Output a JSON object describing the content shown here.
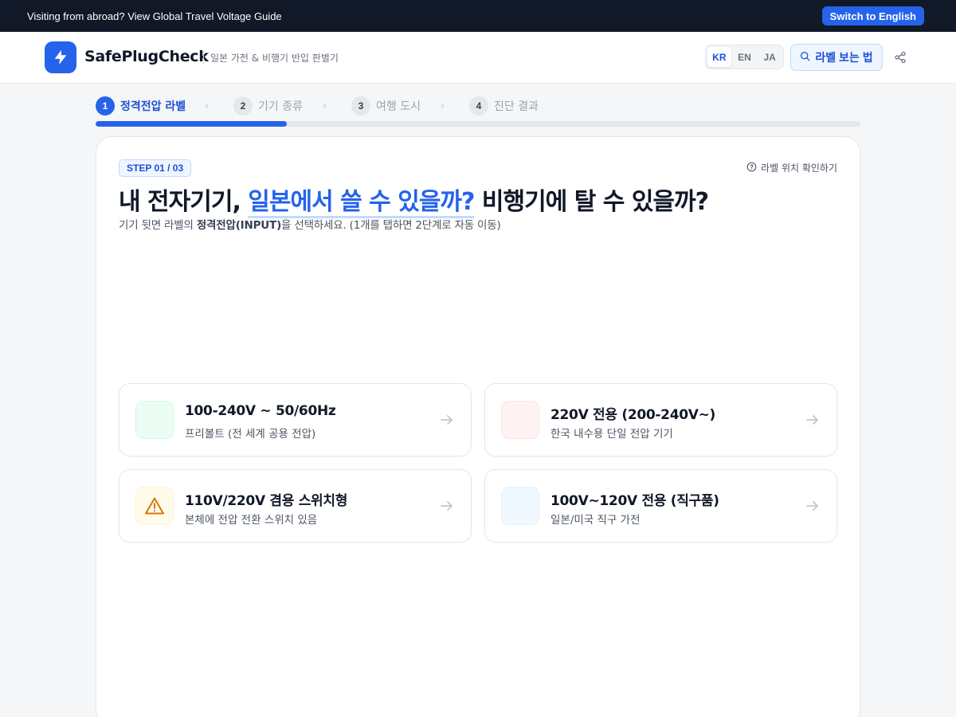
{
  "banner": {
    "text": "Visiting from abroad? View Global Travel Voltage Guide",
    "button": "Switch to English"
  },
  "header": {
    "brand": "SafePlugCheck",
    "subtitle": "일본 가전 & 비행기 반입 판별기",
    "languages": [
      "KR",
      "EN",
      "JA"
    ],
    "active_language": "KR",
    "label_guide_button": "라벨 보는 법",
    "icons": {
      "logo": "lightning-bolt-icon",
      "search": "search-icon",
      "share": "share-icon"
    }
  },
  "stepper": {
    "steps": [
      {
        "num": "1",
        "label": "정격전압 라벨"
      },
      {
        "num": "2",
        "label": "기기 종류"
      },
      {
        "num": "3",
        "label": "여행 도시"
      },
      {
        "num": "4",
        "label": "진단 결과"
      }
    ],
    "active_step": 1,
    "progress_fraction": 0.25
  },
  "card": {
    "badge": "STEP 01 / 03",
    "location_link": "라벨 위치 확인하기",
    "headline_pre": "내 전자기기, ",
    "headline_highlight": "일본에서 쓸 수 있을까?",
    "headline_post": " 비행기에 탈 수 있을까?",
    "sub_pre": "기기 뒷면 라벨의 ",
    "sub_bold": "정격전압(INPUT)",
    "sub_post": "을 선택하세요. (1개를 탭하면 2단계로 자동 이동)"
  },
  "options": [
    {
      "title": "100-240V ~ 50/60Hz",
      "desc": "프리볼트 (전 세계 공용 전압)",
      "bg": "#ecfdf5",
      "border": "#d1fae5",
      "icon": ""
    },
    {
      "title": "220V 전용 (200-240V~)",
      "desc": "한국 내수용 단일 전압 기기",
      "bg": "#fef2f2",
      "border": "#fee2e2",
      "icon": ""
    },
    {
      "title": "110V/220V 겸용 스위치형",
      "desc": "본체에 전압 전환 스위치 있음",
      "bg": "#fffbeb",
      "border": "#fef3c7",
      "icon": "warning-icon"
    },
    {
      "title": "100V~120V 전용 (직구품)",
      "desc": "일본/미국 직구 가전",
      "bg": "#f0f9ff",
      "border": "#e0f2fe",
      "icon": ""
    }
  ]
}
